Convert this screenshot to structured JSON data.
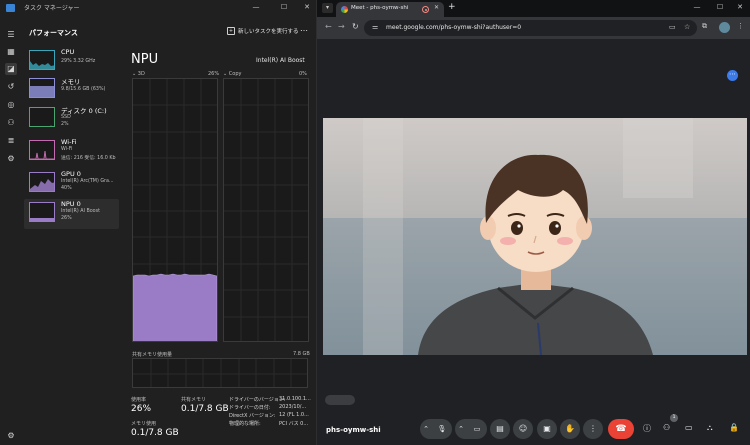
{
  "taskmanager": {
    "title": "タスク マネージャー",
    "section_title": "パフォーマンス",
    "new_task_label": "新しいタスクを実行する",
    "more_label": "…",
    "items": [
      {
        "name": "CPU",
        "sub1": "29% 3.32 GHz",
        "sub2": ""
      },
      {
        "name": "メモリ",
        "sub1": "9.8/15.6 GB (63%)",
        "sub2": ""
      },
      {
        "name": "ディスク 0 (C:)",
        "sub1": "SSD",
        "sub2": "2%"
      },
      {
        "name": "Wi-Fi",
        "sub1": "Wi-Fi",
        "sub2": "送信: 216 受信: 16.0 Kb"
      },
      {
        "name": "GPU 0",
        "sub1": "Intel(R) Arc(TM) Gra...",
        "sub2": "40%"
      },
      {
        "name": "NPU 0",
        "sub1": "Intel(R) AI Boost",
        "sub2": "26%"
      }
    ],
    "detail": {
      "title": "NPU",
      "device": "Intel(R) AI Boost",
      "graph1_label": "3D",
      "graph1_pct": "26%",
      "graph2_label": "Copy",
      "graph2_pct": "0%",
      "shared_memory_label": "共有メモリ使用量",
      "shared_memory_max": "7.8 GB",
      "utilization_label": "使用率",
      "utilization_value": "26%",
      "shared_label": "共有メモリ",
      "shared_value": "0.1/7.8 GB",
      "memory_label": "メモリ使用",
      "memory_value": "0.1/7.8 GB",
      "driver_info": [
        {
          "k": "ドライバーのバージョン:",
          "v": "31.0.100.1..."
        },
        {
          "k": "ドライバーの日付:",
          "v": "2023/10/..."
        },
        {
          "k": "DirectX バージョン:",
          "v": "12 (FL 1.0..."
        },
        {
          "k": "物理的な場所:",
          "v": "PCI バス 0..."
        }
      ]
    }
  },
  "chrome": {
    "tab_title": "Meet - phs-oymw-shi",
    "url": "meet.google.com/phs-oymw-shi?authuser=0"
  },
  "meet": {
    "meeting_code": "phs-oymw-shi",
    "participants_badge": "1"
  },
  "colors": {
    "npu_fill": "#9a7bc6",
    "end_call": "#ea4335",
    "cpu": "#3aa6b9",
    "memory": "#8d8fd6",
    "disk": "#4aa56e",
    "wifi": "#c36bb0",
    "gpu": "#9a7bc6"
  }
}
